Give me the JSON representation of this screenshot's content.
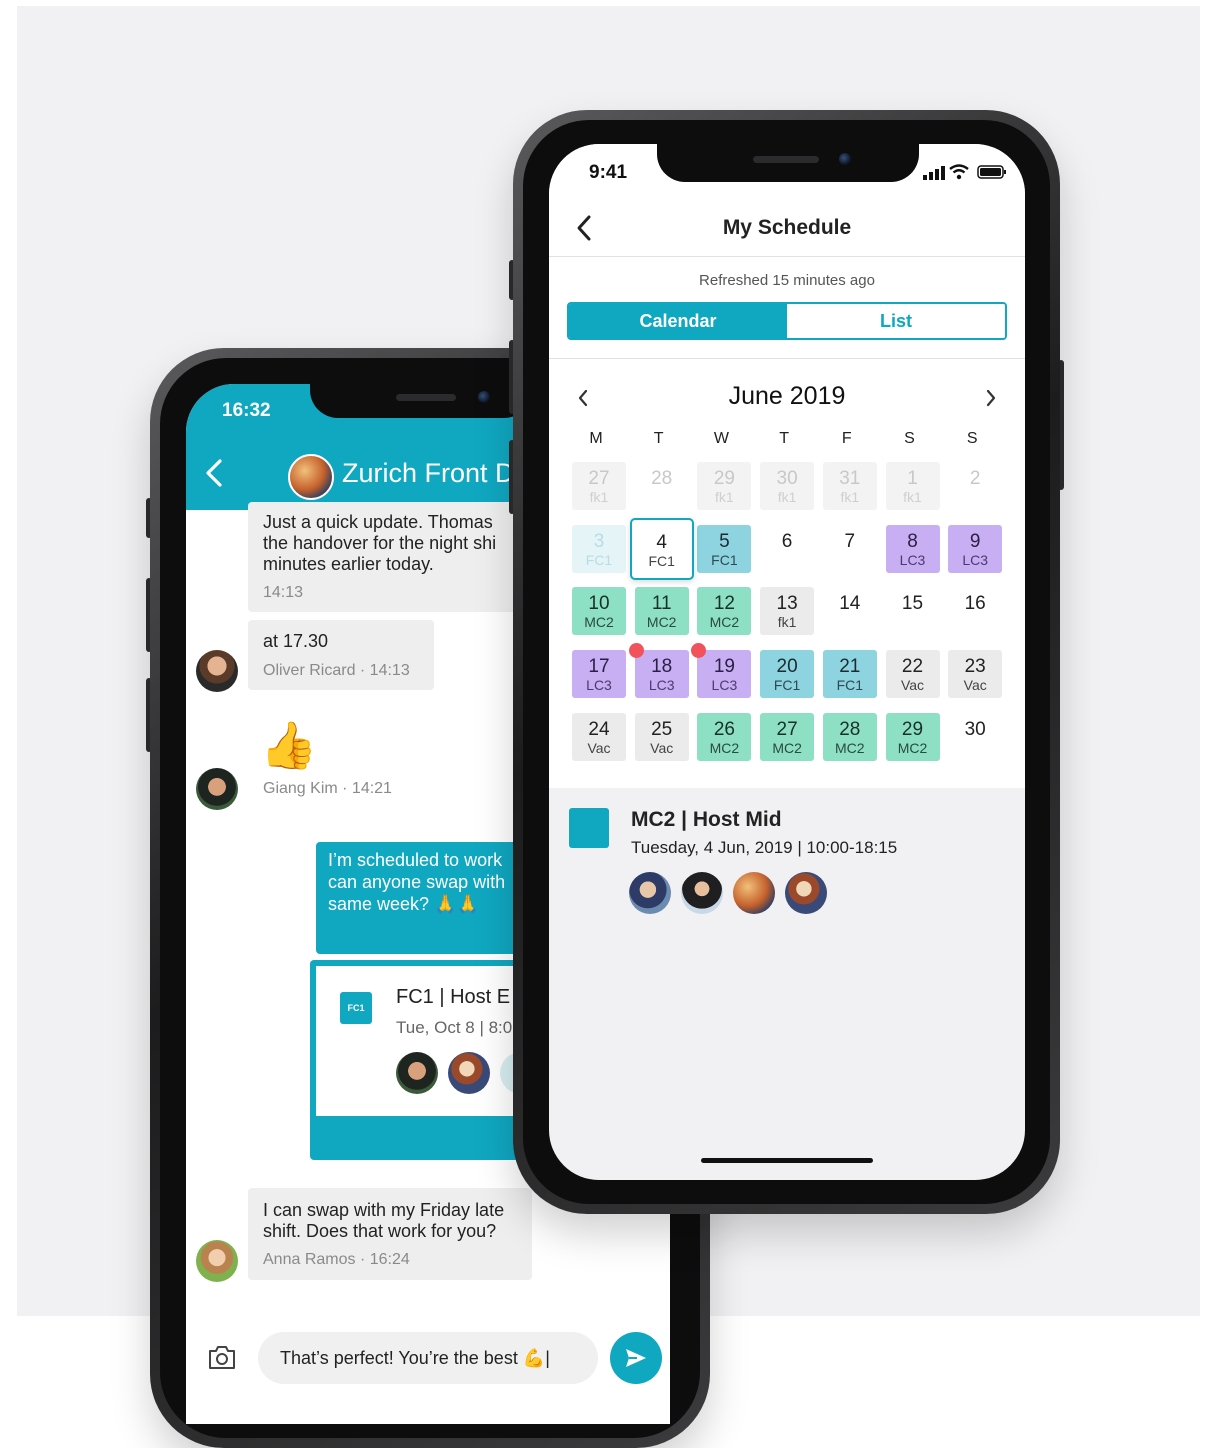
{
  "chat": {
    "status_time": "16:32",
    "title": "Zurich Front Desk",
    "messages": [
      {
        "lines": [
          "Just a quick update. Thomas",
          "the handover for the night shi",
          "minutes earlier today."
        ],
        "time": "14:13"
      },
      {
        "text": "at 17.30",
        "meta": "Oliver Ricard · 14:13"
      },
      {
        "emoji": "👍",
        "meta": "Giang Kim · 14:21"
      },
      {
        "lines": [
          "I’m scheduled to work",
          "can anyone swap with",
          "same week? 🙏🙏"
        ]
      },
      {
        "lines": [
          "I can swap with my Friday late",
          "shift. Does that work for you?"
        ],
        "meta": "Anna Ramos  · 16:24"
      }
    ],
    "shared_shift": {
      "badge": "FC1",
      "title": "FC1 | Host E",
      "subtitle": "Tue, Oct 8 | 8:0"
    },
    "input_value": "That’s perfect! You’re the best 💪|"
  },
  "schedule": {
    "status_time": "9:41",
    "title": "My Schedule",
    "refreshed": "Refreshed 15 minutes ago",
    "tabs": [
      "Calendar",
      "List"
    ],
    "active_tab": "Calendar",
    "month": "June 2019",
    "weekdays": [
      "M",
      "T",
      "W",
      "T",
      "F",
      "S",
      "S"
    ],
    "weeks": [
      [
        {
          "d": "27",
          "s": "fk1",
          "t": "out"
        },
        {
          "d": "28",
          "s": "",
          "t": "out-plain"
        },
        {
          "d": "29",
          "s": "fk1",
          "t": "out"
        },
        {
          "d": "30",
          "s": "fk1",
          "t": "out"
        },
        {
          "d": "31",
          "s": "fk1",
          "t": "out"
        },
        {
          "d": "1",
          "s": "fk1",
          "t": "out"
        },
        {
          "d": "2",
          "s": "",
          "t": "out-plain"
        }
      ],
      [
        {
          "d": "3",
          "s": "FC1",
          "t": "fc-faded"
        },
        {
          "d": "4",
          "s": "FC1",
          "t": "selected"
        },
        {
          "d": "5",
          "s": "FC1",
          "t": "fc"
        },
        {
          "d": "6",
          "s": "",
          "t": "plain"
        },
        {
          "d": "7",
          "s": "",
          "t": "plain"
        },
        {
          "d": "8",
          "s": "LC3",
          "t": "lc"
        },
        {
          "d": "9",
          "s": "LC3",
          "t": "lc"
        }
      ],
      [
        {
          "d": "10",
          "s": "MC2",
          "t": "mc"
        },
        {
          "d": "11",
          "s": "MC2",
          "t": "mc"
        },
        {
          "d": "12",
          "s": "MC2",
          "t": "mc"
        },
        {
          "d": "13",
          "s": "fk1",
          "t": "grey"
        },
        {
          "d": "14",
          "s": "",
          "t": "plain"
        },
        {
          "d": "15",
          "s": "",
          "t": "plain"
        },
        {
          "d": "16",
          "s": "",
          "t": "plain"
        }
      ],
      [
        {
          "d": "17",
          "s": "LC3",
          "t": "lc"
        },
        {
          "d": "18",
          "s": "LC3",
          "t": "lc",
          "dot": true
        },
        {
          "d": "19",
          "s": "LC3",
          "t": "lc",
          "dot": true
        },
        {
          "d": "20",
          "s": "FC1",
          "t": "fc"
        },
        {
          "d": "21",
          "s": "FC1",
          "t": "fc"
        },
        {
          "d": "22",
          "s": "Vac",
          "t": "grey"
        },
        {
          "d": "23",
          "s": "Vac",
          "t": "grey"
        }
      ],
      [
        {
          "d": "24",
          "s": "Vac",
          "t": "grey"
        },
        {
          "d": "25",
          "s": "Vac",
          "t": "grey"
        },
        {
          "d": "26",
          "s": "MC2",
          "t": "mc"
        },
        {
          "d": "27",
          "s": "MC2",
          "t": "mc"
        },
        {
          "d": "28",
          "s": "MC2",
          "t": "mc"
        },
        {
          "d": "29",
          "s": "MC2",
          "t": "mc"
        },
        {
          "d": "30",
          "s": "",
          "t": "plain"
        }
      ]
    ],
    "detail": {
      "title": "MC2 | Host Mid",
      "subtitle": "Tuesday, 4 Jun, 2019 | 10:00-18:15",
      "avatar_count": 4
    }
  },
  "colors": {
    "teal": "#10a7c1",
    "mc": "#8ee0c4",
    "fc": "#8dd3e0",
    "lc": "#c8aef2",
    "grey": "#ebebeb",
    "dot": "#f2525c"
  }
}
